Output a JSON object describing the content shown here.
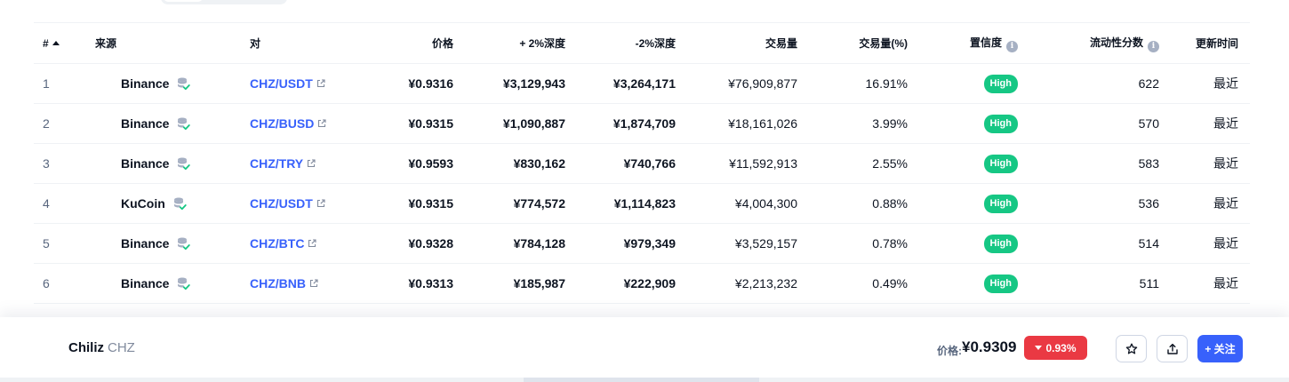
{
  "header": {
    "num": "#",
    "source": "来源",
    "pair": "对",
    "price": "价格",
    "plus_depth": "+ 2%深度",
    "minus_depth": "-2%深度",
    "volume": "交易量",
    "volume_pct": "交易量(%)",
    "confidence": "置信度",
    "liquidity": "流动性分数",
    "updated": "更新时间"
  },
  "rows": [
    {
      "num": "1",
      "exchange": "Binance",
      "pair": "CHZ/USDT",
      "price": "¥0.9316",
      "plus_depth": "¥3,129,943",
      "minus_depth": "¥3,264,171",
      "volume": "¥76,909,877",
      "volume_pct": "16.91%",
      "confidence": "High",
      "liquidity": "622",
      "updated": "最近"
    },
    {
      "num": "2",
      "exchange": "Binance",
      "pair": "CHZ/BUSD",
      "price": "¥0.9315",
      "plus_depth": "¥1,090,887",
      "minus_depth": "¥1,874,709",
      "volume": "¥18,161,026",
      "volume_pct": "3.99%",
      "confidence": "High",
      "liquidity": "570",
      "updated": "最近"
    },
    {
      "num": "3",
      "exchange": "Binance",
      "pair": "CHZ/TRY",
      "price": "¥0.9593",
      "plus_depth": "¥830,162",
      "minus_depth": "¥740,766",
      "volume": "¥11,592,913",
      "volume_pct": "2.55%",
      "confidence": "High",
      "liquidity": "583",
      "updated": "最近"
    },
    {
      "num": "4",
      "exchange": "KuCoin",
      "pair": "CHZ/USDT",
      "price": "¥0.9315",
      "plus_depth": "¥774,572",
      "minus_depth": "¥1,114,823",
      "volume": "¥4,004,300",
      "volume_pct": "0.88%",
      "confidence": "High",
      "liquidity": "536",
      "updated": "最近"
    },
    {
      "num": "5",
      "exchange": "Binance",
      "pair": "CHZ/BTC",
      "price": "¥0.9328",
      "plus_depth": "¥784,128",
      "minus_depth": "¥979,349",
      "volume": "¥3,529,157",
      "volume_pct": "0.78%",
      "confidence": "High",
      "liquidity": "514",
      "updated": "最近"
    },
    {
      "num": "6",
      "exchange": "Binance",
      "pair": "CHZ/BNB",
      "price": "¥0.9313",
      "plus_depth": "¥185,987",
      "minus_depth": "¥222,909",
      "volume": "¥2,213,232",
      "volume_pct": "0.49%",
      "confidence": "High",
      "liquidity": "511",
      "updated": "最近"
    }
  ],
  "footer": {
    "coin_name": "Chiliz",
    "coin_symbol": "CHZ",
    "price_label": "价格:",
    "price": "¥0.9309",
    "change": "0.93%",
    "follow_label": "+ 关注"
  },
  "icons": {
    "sort": "sort-ascending-icon",
    "info": "info-icon",
    "exchange_verified": "database-check-icon",
    "external_link": "external-link-icon",
    "watchlist": "star-icon",
    "share": "share-icon",
    "change_direction": "caret-down-icon"
  },
  "colors": {
    "link": "#3861fb",
    "high_badge": "#16c784",
    "negative": "#ea3943",
    "primary_button": "#3861fb"
  }
}
